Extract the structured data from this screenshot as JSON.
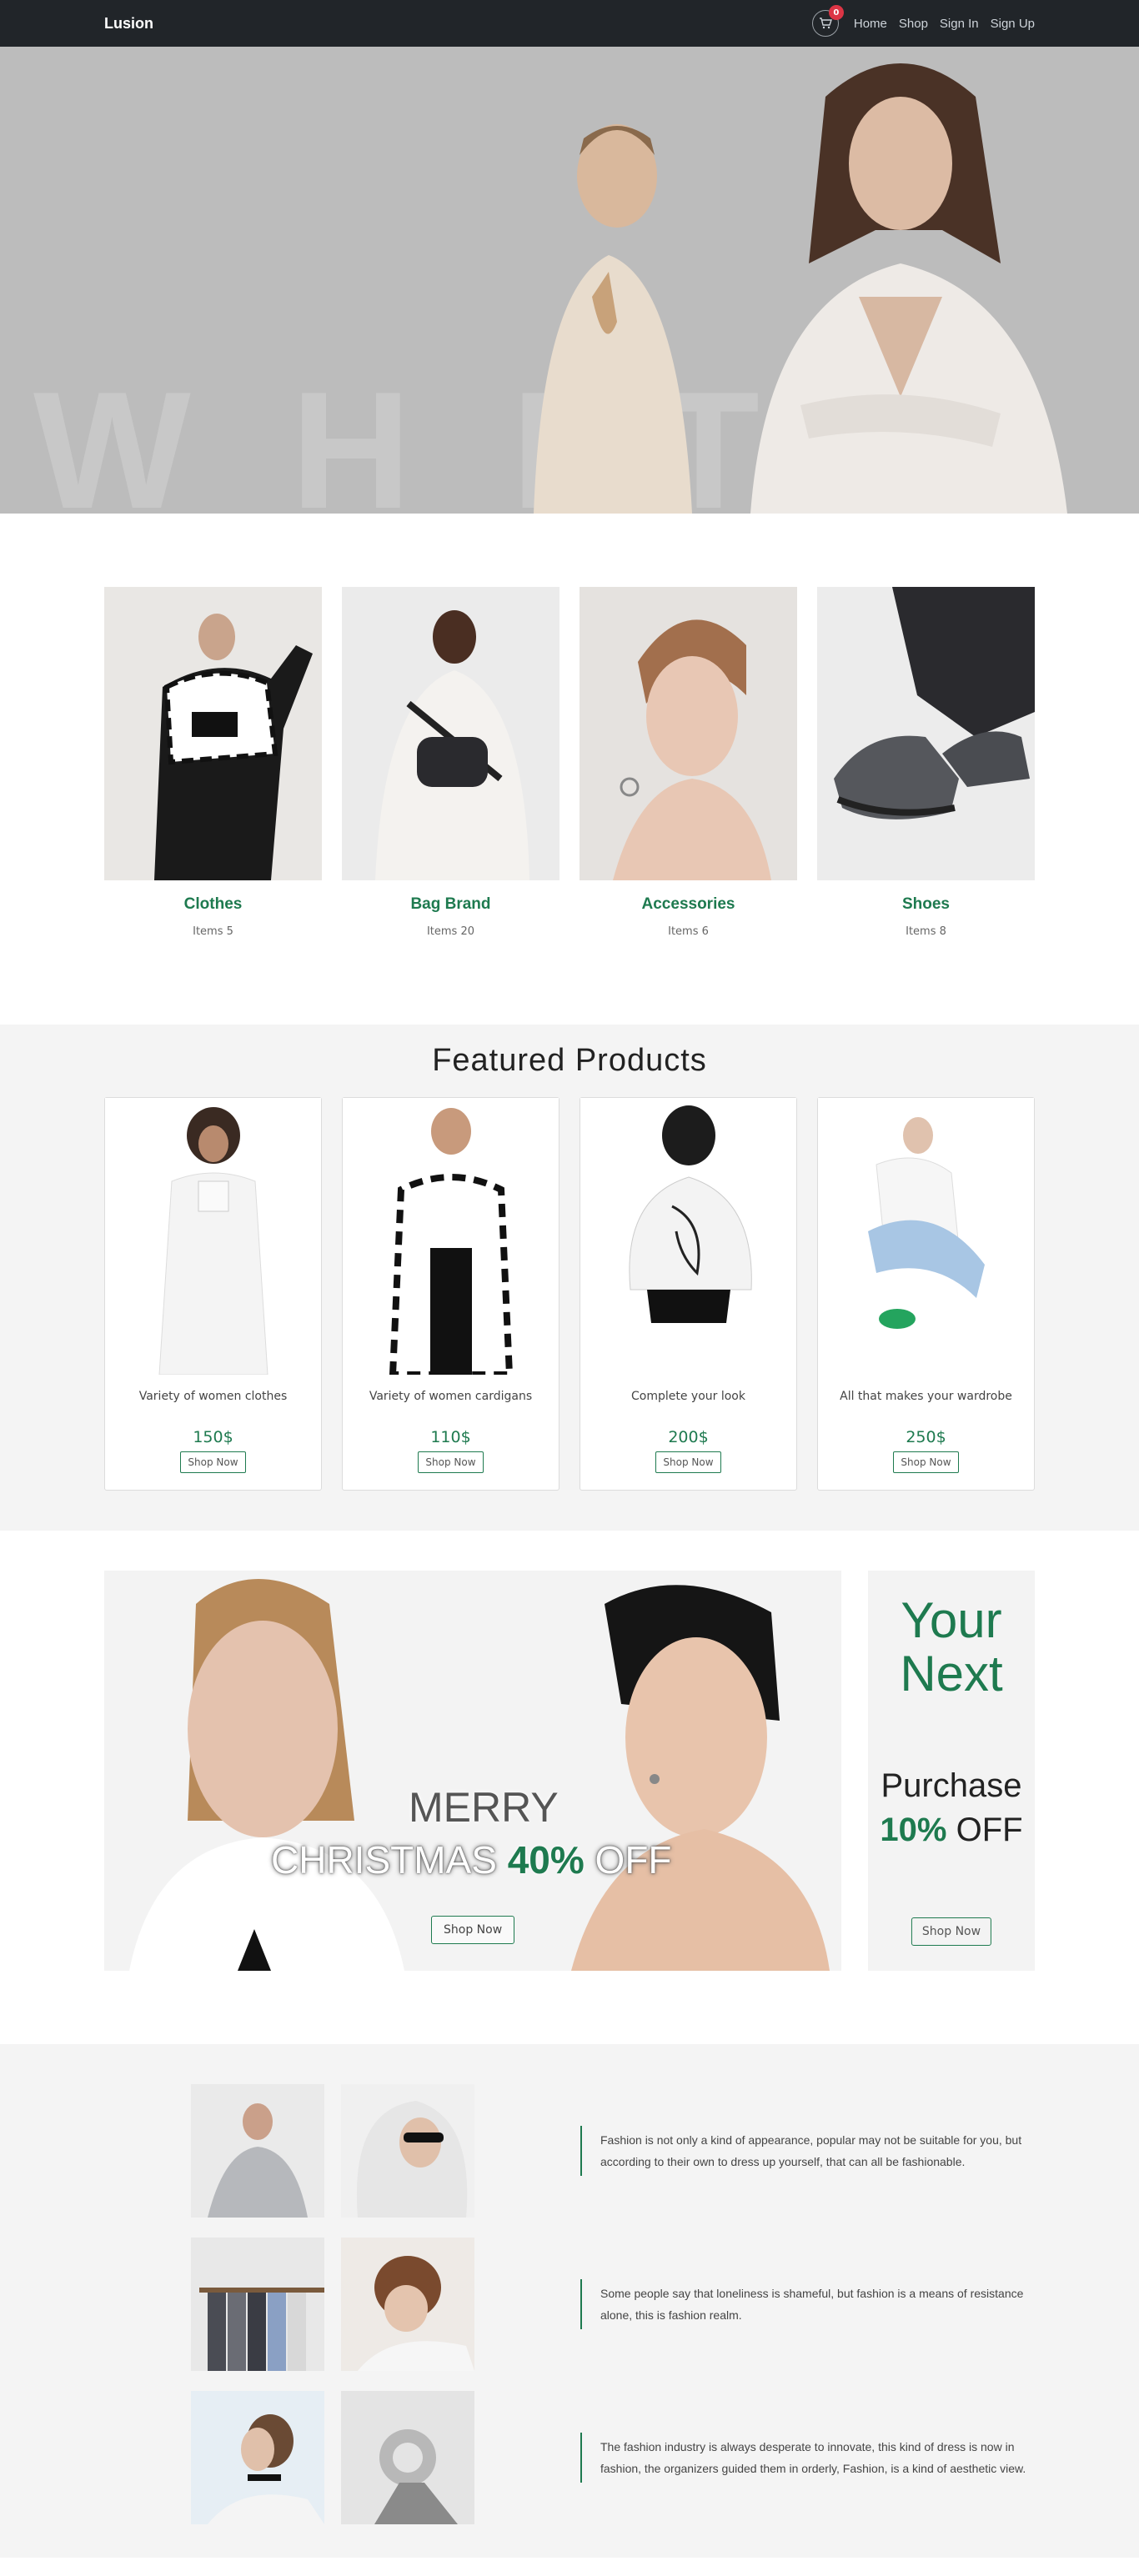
{
  "nav": {
    "brand": "Lusion",
    "cart_count": "0",
    "links": [
      "Home",
      "Shop",
      "Sign In",
      "Sign Up"
    ]
  },
  "hero": {
    "watermark": "WHITE"
  },
  "categories": [
    {
      "title": "Clothes",
      "subtitle": "Items 5"
    },
    {
      "title": "Bag Brand",
      "subtitle": "Items 20"
    },
    {
      "title": "Accessories",
      "subtitle": "Items 6"
    },
    {
      "title": "Shoes",
      "subtitle": "Items 8"
    }
  ],
  "featured": {
    "title": "Featured Products",
    "products": [
      {
        "desc": "Variety of women clothes",
        "price": "150$",
        "button": "Shop Now"
      },
      {
        "desc": "Variety of women cardigans",
        "price": "110$",
        "button": "Shop Now"
      },
      {
        "desc": "Complete your look",
        "price": "200$",
        "button": "Shop Now"
      },
      {
        "desc": "All that makes your wardrobe",
        "price": "250$",
        "button": "Shop Now"
      }
    ]
  },
  "promo": {
    "line1": "MERRY",
    "line2_a": "CHRISTMAS",
    "line2_pct": "40%",
    "line2_b": "OFF",
    "button": "Shop Now",
    "side": {
      "your": "Your",
      "next": "Next",
      "purchase": "Purchase",
      "pct": "10%",
      "off": "OFF",
      "button": "Shop Now"
    }
  },
  "stories": [
    {
      "text": "Fashion is not only a kind of appearance, popular may not be suitable for you, but according to their own to dress up yourself, that can all be fashionable."
    },
    {
      "text": "Some people say that loneliness is shameful, but fashion is a means of resistance alone, this is fashion realm."
    },
    {
      "text": "The fashion industry is always desperate to innovate, this kind of dress is now in fashion, the organizers guided them in orderly, Fashion, is a kind of aesthetic view."
    }
  ],
  "colors": {
    "accent": "#1e7a4f",
    "navbar": "#212529",
    "badge": "#dc3545"
  }
}
